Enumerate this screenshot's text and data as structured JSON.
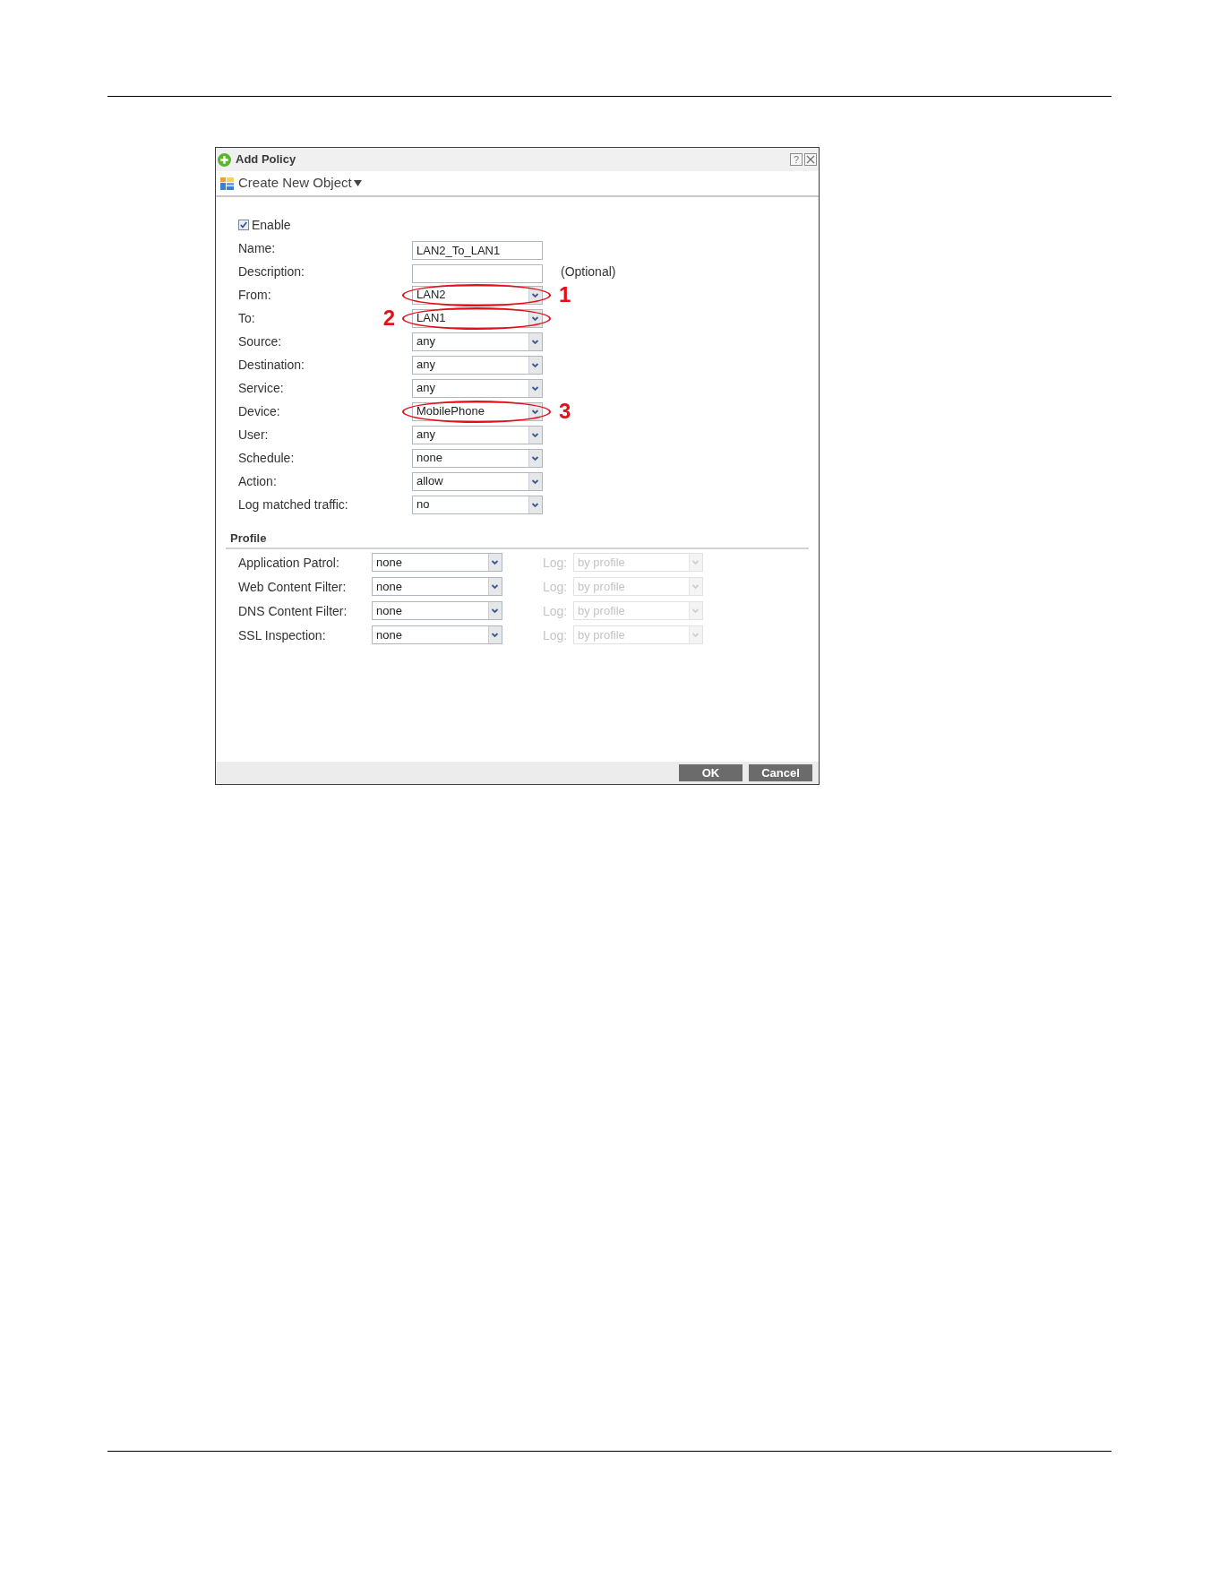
{
  "dialog": {
    "title": "Add Policy",
    "help_button": "?"
  },
  "toolbar": [
    {
      "label": "Create New Object",
      "has_menu": true
    }
  ],
  "enable": {
    "label": "Enable",
    "checked": true
  },
  "fields": [
    {
      "label": "Name:",
      "kind": "text",
      "value": "LAN2_To_LAN1"
    },
    {
      "label": "Description:",
      "kind": "text",
      "note": "(Optional)"
    },
    {
      "label": "From:",
      "kind": "select",
      "value": "LAN2",
      "callout": {
        "number": "1",
        "kind": "right"
      }
    },
    {
      "label": "To:",
      "kind": "select",
      "value": "LAN1",
      "callout": {
        "number": "2",
        "kind": "left"
      }
    },
    {
      "label": "Source:",
      "kind": "select",
      "value": "any"
    },
    {
      "label": "Destination:",
      "kind": "select",
      "value": "any"
    },
    {
      "label": "Service:",
      "kind": "select",
      "value": "any"
    },
    {
      "label": "Device:",
      "kind": "select",
      "value": "MobilePhone",
      "callout": {
        "number": "3",
        "kind": "right"
      }
    },
    {
      "label": "User:",
      "kind": "select",
      "value": "any"
    },
    {
      "label": "Schedule:",
      "kind": "select",
      "value": "none"
    },
    {
      "label": "Action:",
      "kind": "select",
      "value": "allow"
    },
    {
      "label": "Log matched traffic:",
      "kind": "select",
      "value": "no"
    }
  ],
  "profile": {
    "title": "Profile",
    "rows": [
      {
        "label": "Application Patrol:",
        "value": "none",
        "log": {
          "label": "Log:",
          "value": "by profile",
          "disabled": true
        }
      },
      {
        "label": "Web Content Filter:",
        "value": "none",
        "log": {
          "label": "Log:",
          "value": "by profile",
          "disabled": true
        }
      },
      {
        "label": "DNS Content Filter:",
        "value": "none",
        "log": {
          "label": "Log:",
          "value": "by profile",
          "disabled": true
        }
      },
      {
        "label": "SSL Inspection:",
        "value": "none",
        "log": {
          "label": "Log:",
          "value": "by profile",
          "disabled": true
        }
      }
    ]
  },
  "buttons": [
    {
      "label": "OK"
    },
    {
      "label": "Cancel"
    }
  ]
}
